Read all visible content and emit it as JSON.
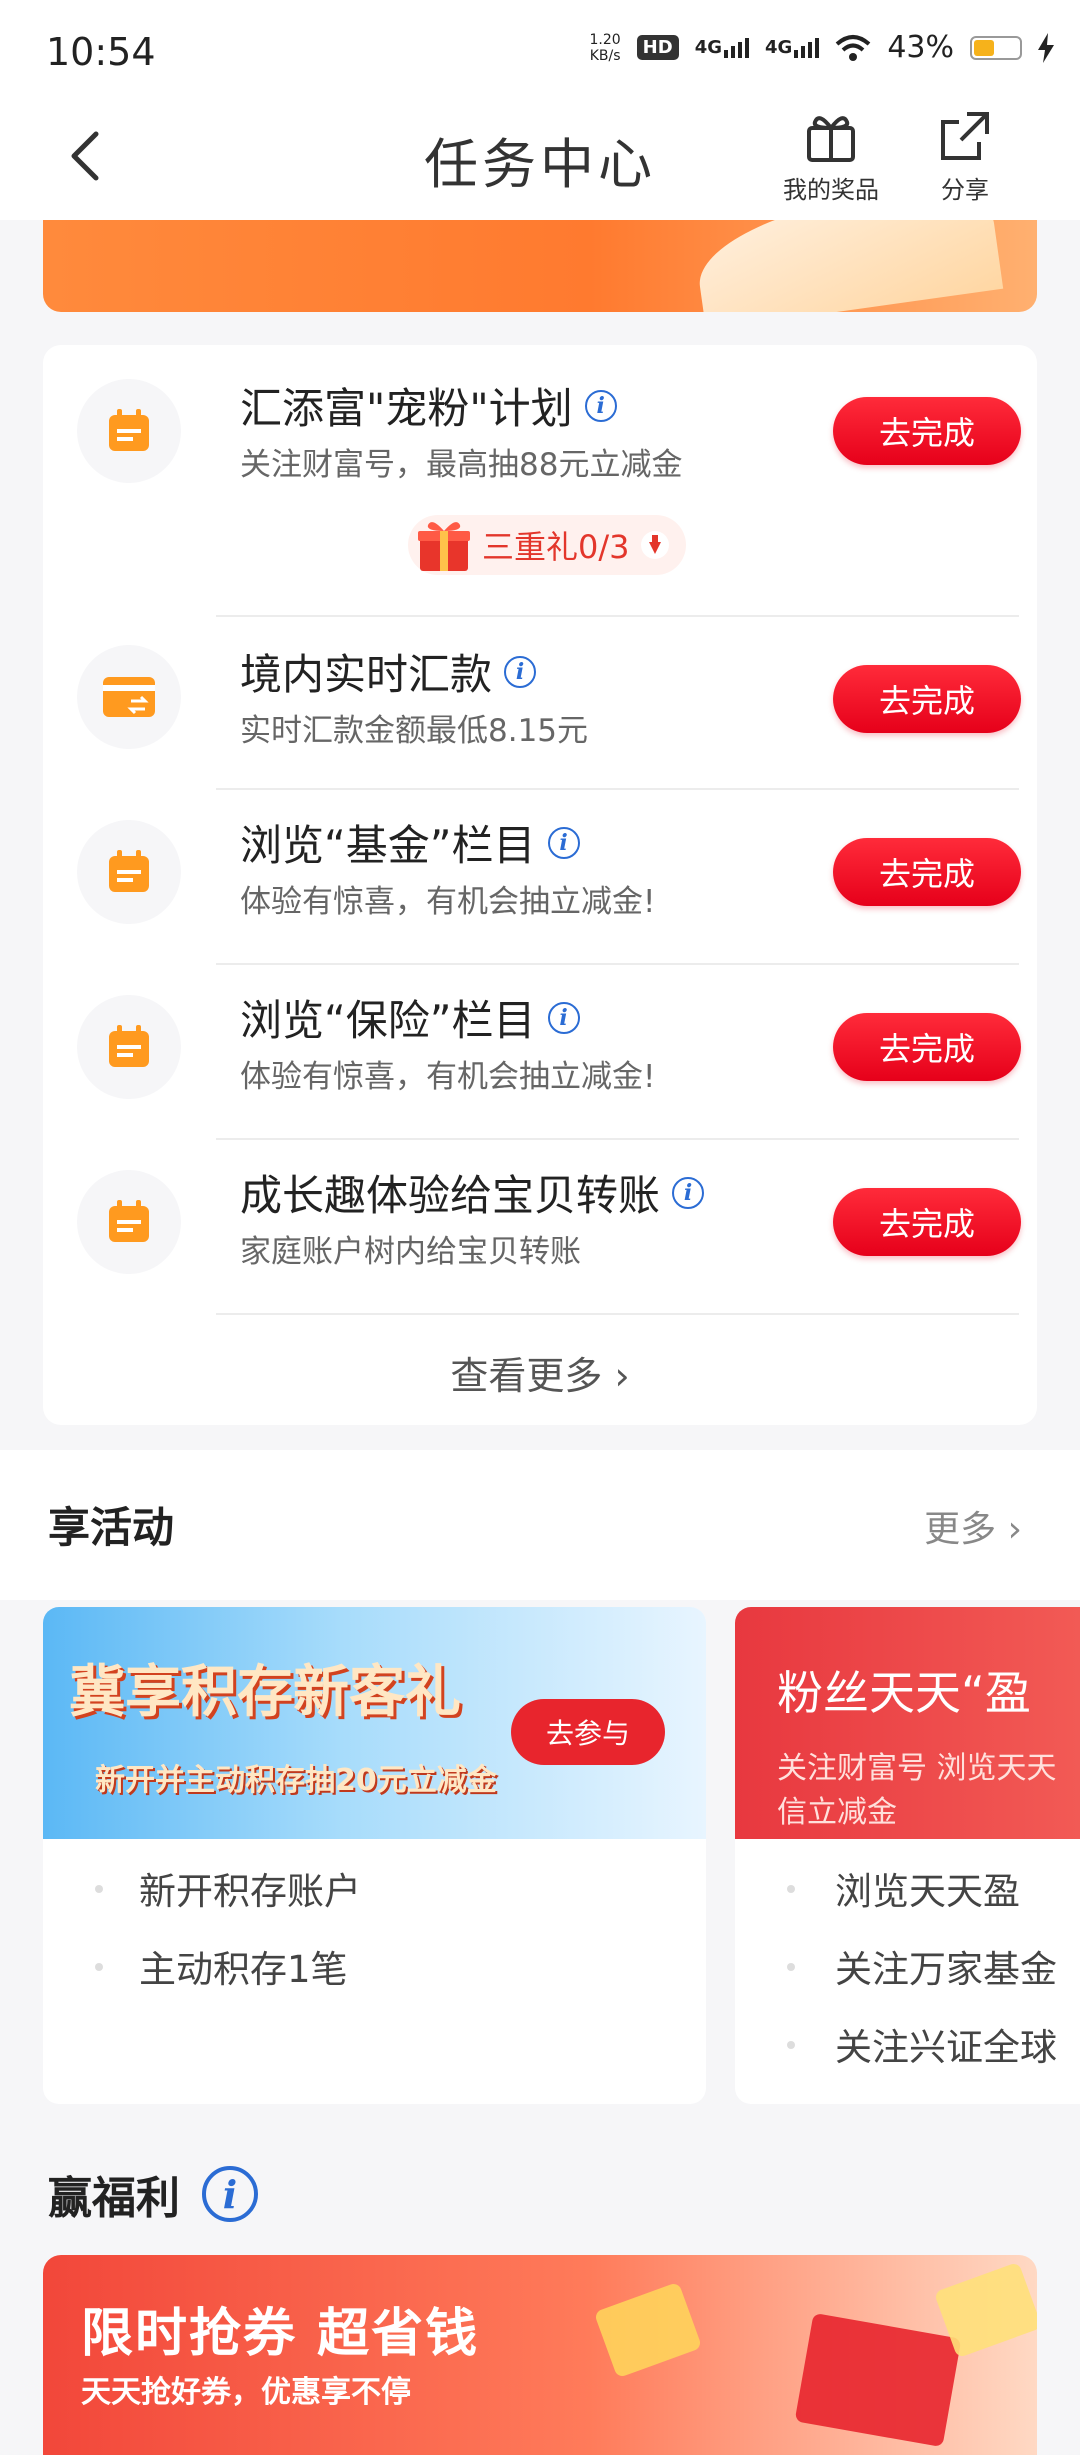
{
  "status_bar": {
    "time": "10:54",
    "net_speed_value": "1.20",
    "net_speed_unit": "KB/s",
    "hd": "HD",
    "signal_1": "4G",
    "signal_2": "4G",
    "battery_percent": "43%"
  },
  "nav": {
    "title": "任务中心",
    "my_prizes": "我的奖品",
    "share": "分享"
  },
  "tasks": [
    {
      "title": "汇添富\"宠粉\"计划",
      "subtitle": "关注财富号，最高抽88元立减金",
      "button": "去完成",
      "icon": "calendar-icon"
    },
    {
      "title": "境内实时汇款",
      "subtitle": "实时汇款金额最低8.15元",
      "button": "去完成",
      "icon": "card-transfer-icon"
    },
    {
      "title": "浏览“基金”栏目",
      "subtitle": "体验有惊喜，有机会抽立减金!",
      "button": "去完成",
      "icon": "calendar-icon"
    },
    {
      "title": "浏览“保险”栏目",
      "subtitle": "体验有惊喜，有机会抽立减金!",
      "button": "去完成",
      "icon": "calendar-icon"
    },
    {
      "title": "成长趣体验给宝贝转账",
      "subtitle": "家庭账户树内给宝贝转账",
      "button": "去完成",
      "icon": "calendar-icon"
    }
  ],
  "gift_pill": {
    "text": "三重礼0/3"
  },
  "view_more": "查看更多",
  "activities": {
    "title": "享活动",
    "more": "更多",
    "cards": [
      {
        "banner_title": "冀享积存新客礼",
        "banner_sub": "新开并主动积存抽20元立减金",
        "banner_button": "去参与",
        "items": [
          "新开积存账户",
          "主动积存1笔"
        ]
      },
      {
        "banner_title": "粉丝天天“盈",
        "banner_sub": "关注财富号 浏览天天",
        "banner_sub2": "信立减金",
        "items": [
          "浏览天天盈",
          "关注万家基金",
          "关注兴证全球"
        ]
      }
    ]
  },
  "welfare": {
    "title": "赢福利",
    "promo_title": "限时抢券 超省钱",
    "promo_sub": "天天抢好券，优惠享不停"
  },
  "colors": {
    "accent_red": "#e6001a",
    "icon_orange": "#ff9a1f",
    "info_blue": "#2b6cd4"
  }
}
